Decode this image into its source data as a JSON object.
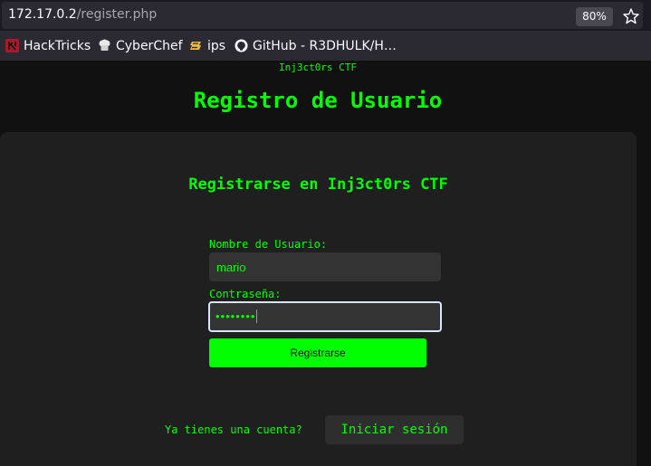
{
  "browser": {
    "url_host": "172.17.0.2",
    "url_path": "/register.php",
    "zoom": "80%",
    "bookmarks": [
      {
        "label": "HackTricks",
        "icon": "hacktricks-icon"
      },
      {
        "label": "CyberChef",
        "icon": "cyberchef-icon"
      },
      {
        "label": "ips",
        "icon": "folder-icon"
      },
      {
        "label": "GitHub - R3DHULK/H…",
        "icon": "github-icon"
      }
    ]
  },
  "page": {
    "brand": "Inj3ct0rs CTF",
    "title": "Registro de Usuario",
    "form_title": "Registrarse en Inj3ct0rs CTF",
    "username_label": "Nombre de Usuario:",
    "username_value": "mario",
    "password_label": "Contraseña:",
    "password_masked": "••••••••",
    "register_button": "Registrarse",
    "login_prompt": "Ya tienes una cuenta?",
    "login_button": "Iniciar sesión"
  },
  "colors": {
    "accent": "#00ff00",
    "background": "#111111",
    "card": "#1f1f1f"
  }
}
